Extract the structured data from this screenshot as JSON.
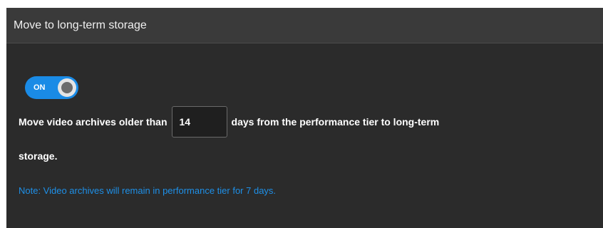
{
  "panel": {
    "title": "Move to long-term storage"
  },
  "toggle": {
    "state_label": "ON",
    "on": true,
    "color": "#1a8be6"
  },
  "setting": {
    "text_before": "Move video archives older than",
    "days_value": "14",
    "text_after": "days from the performance tier to long-term",
    "text_wrap": "storage."
  },
  "note": {
    "text": "Note: Video archives will remain in performance tier for 7 days.",
    "color": "#1e90e8"
  }
}
